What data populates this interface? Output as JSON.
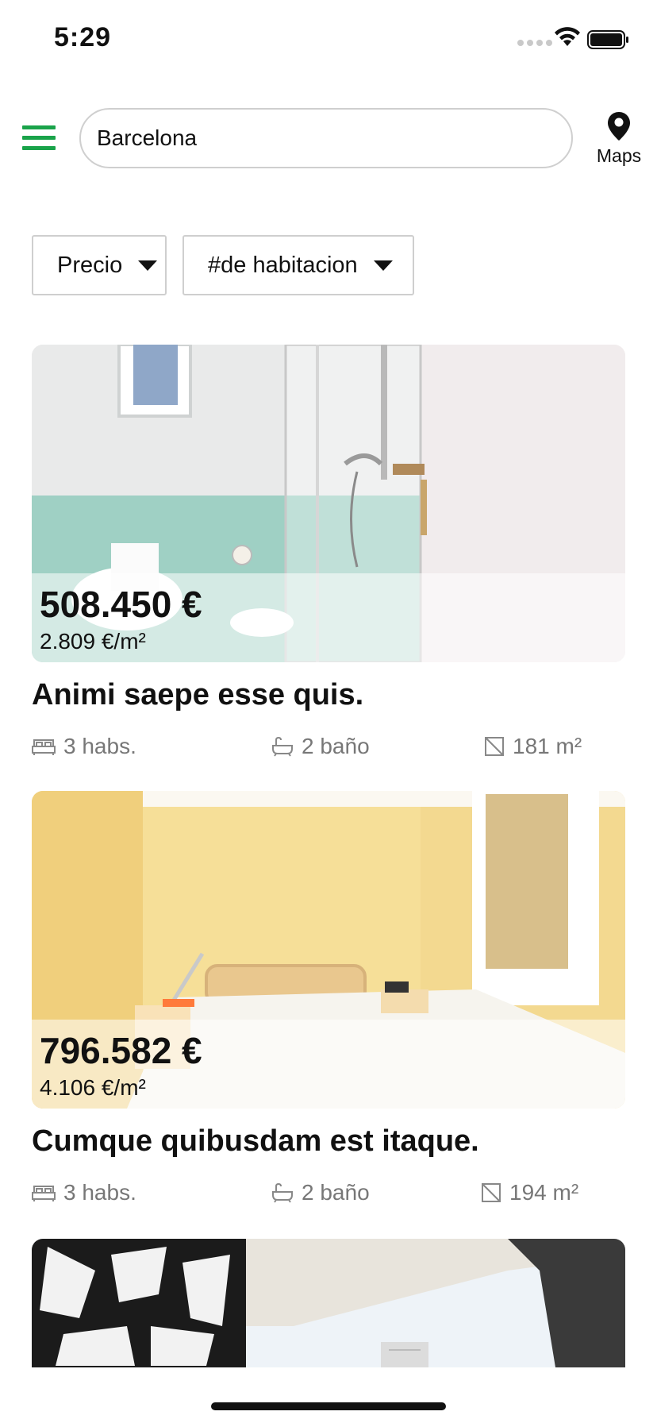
{
  "status_bar": {
    "time": "5:29"
  },
  "header": {
    "search_value": "Barcelona",
    "maps_label": "Maps",
    "accent_color": "#1aa34a"
  },
  "filters": [
    {
      "label": "Precio"
    },
    {
      "label": "#de habitacion"
    }
  ],
  "listings": [
    {
      "image": "bathroom-photo",
      "price": "508.450 €",
      "price_per_m2": "2.809 €/m²",
      "title": "Animi saepe esse quis.",
      "rooms": "3 habs.",
      "baths": "2 baño",
      "area": "181 m²"
    },
    {
      "image": "bedroom-photo",
      "price": "796.582 €",
      "price_per_m2": "4.106 €/m²",
      "title": "Cumque quibusdam est itaque.",
      "rooms": "3 habs.",
      "baths": "2 baño",
      "area": "194 m²"
    },
    {
      "image": "terrace-photo"
    }
  ]
}
